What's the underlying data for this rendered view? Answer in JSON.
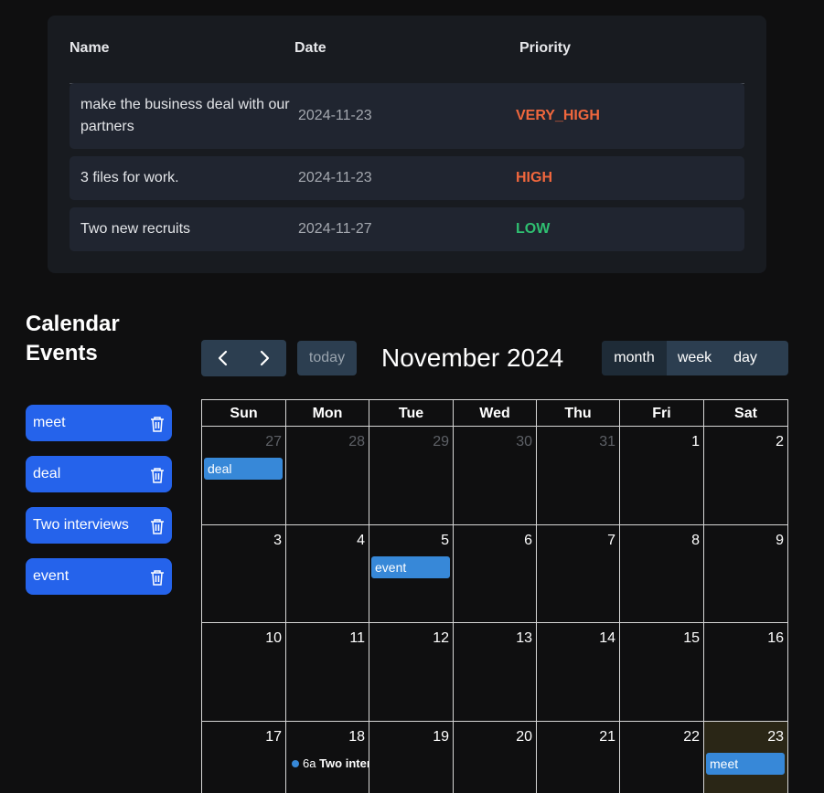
{
  "tasks": {
    "headers": {
      "name": "Name",
      "date": "Date",
      "priority": "Priority"
    },
    "rows": [
      {
        "name": "make the business deal with our partners",
        "date": "2024-11-23",
        "priority": "VERY_HIGH",
        "priority_color": "#f0673d"
      },
      {
        "name": "3 files for work.",
        "date": "2024-11-23",
        "priority": "HIGH",
        "priority_color": "#f0673d"
      },
      {
        "name": "Two new recruits",
        "date": "2024-11-27",
        "priority": "LOW",
        "priority_color": "#2fbf71"
      }
    ]
  },
  "sidebar": {
    "title": "Calendar Events",
    "events": [
      {
        "label": "meet",
        "icon": "trash-icon"
      },
      {
        "label": "deal",
        "icon": "trash-icon"
      },
      {
        "label": "Two interviews",
        "icon": "trash-icon"
      },
      {
        "label": "event",
        "icon": "trash-icon"
      }
    ]
  },
  "calendar": {
    "toolbar": {
      "prev_icon": "chevron-left-icon",
      "next_icon": "chevron-right-icon",
      "today_label": "today",
      "title": "November 2024",
      "views": {
        "month": "month",
        "week": "week",
        "day": "day"
      },
      "active_view": "month"
    },
    "weekdays": [
      "Sun",
      "Mon",
      "Tue",
      "Wed",
      "Thu",
      "Fri",
      "Sat"
    ],
    "weeks": [
      [
        "27",
        "28",
        "29",
        "30",
        "31",
        "1",
        "2"
      ],
      [
        "3",
        "4",
        "5",
        "6",
        "7",
        "8",
        "9"
      ],
      [
        "10",
        "11",
        "12",
        "13",
        "14",
        "15",
        "16"
      ],
      [
        "17",
        "18",
        "19",
        "20",
        "21",
        "22",
        "23"
      ]
    ],
    "other_month_days": [
      [
        "27",
        "28",
        "29",
        "30",
        "31"
      ]
    ],
    "today": "23",
    "events": [
      {
        "title": "deal",
        "day": "27"
      },
      {
        "title": "event",
        "day": "5"
      },
      {
        "title": "meet",
        "day": "23"
      }
    ],
    "timed_event": {
      "time": "6a",
      "title": "Two interviews",
      "day": "18"
    },
    "colors": {
      "event": "#3788d8",
      "accent": "#2563eb",
      "toolbar": "#2c3e50",
      "today_bg": "#2a2616"
    }
  }
}
